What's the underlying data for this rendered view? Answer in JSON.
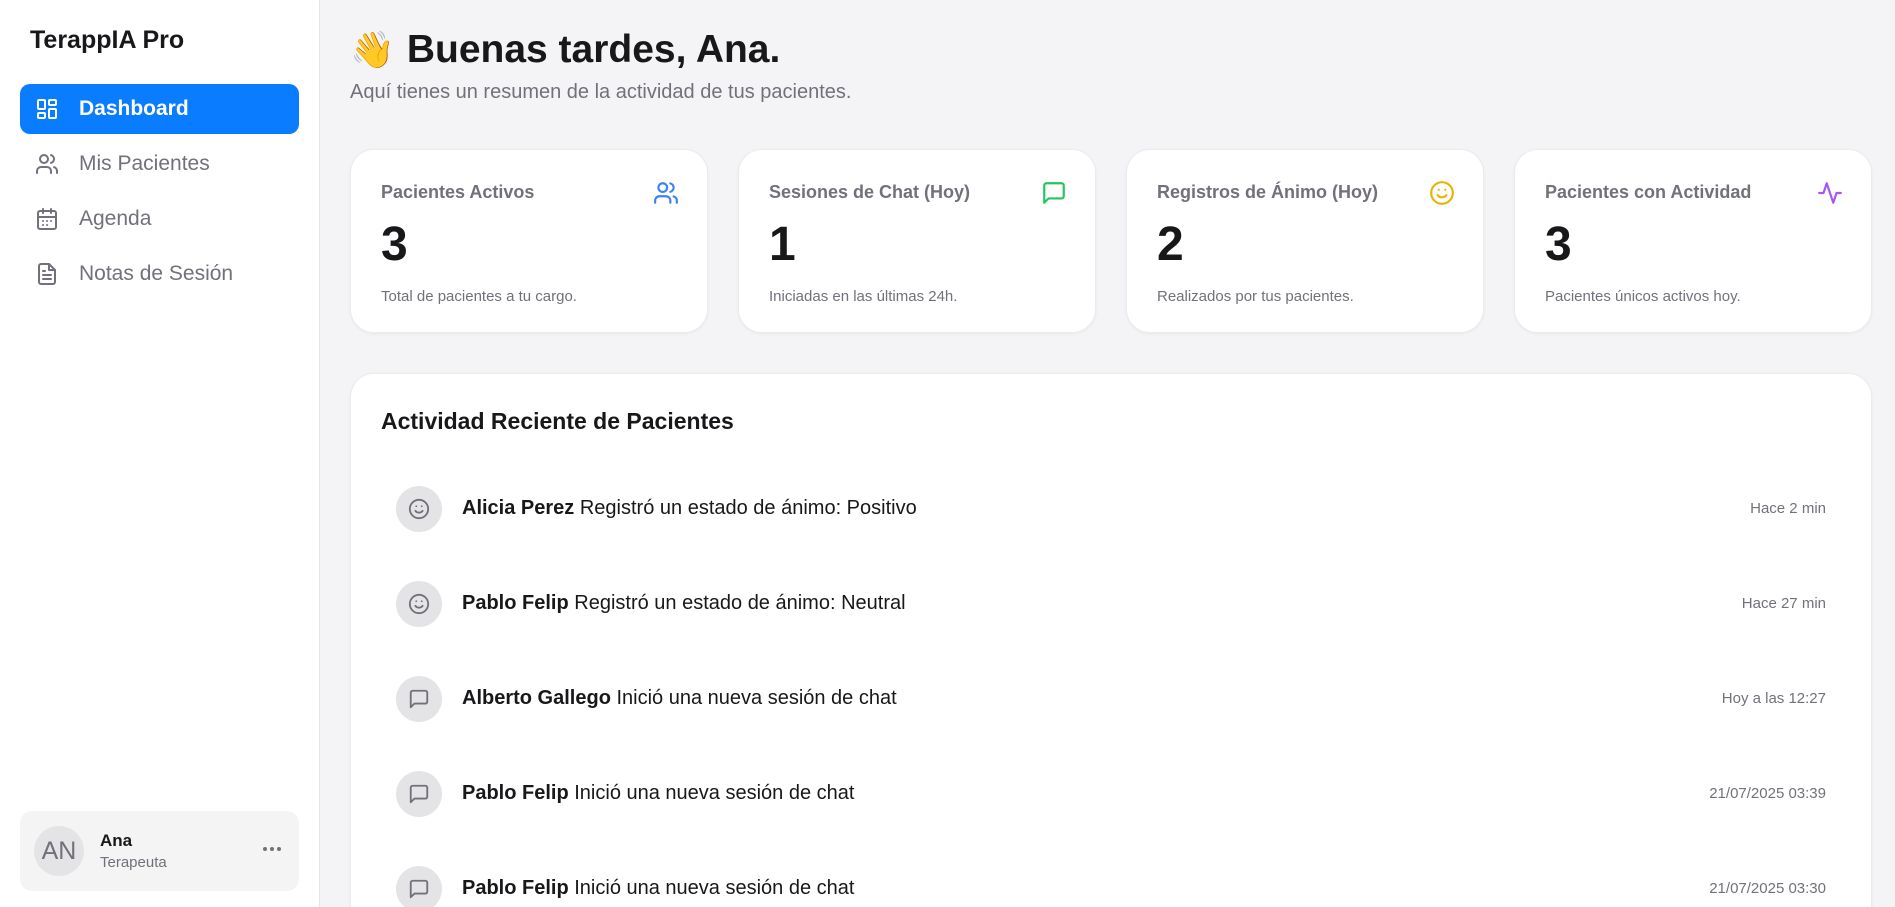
{
  "app": {
    "brand": "TerappIA Pro"
  },
  "sidebar": {
    "items": [
      {
        "label": "Dashboard",
        "icon": "dashboard-icon",
        "active": true
      },
      {
        "label": "Mis Pacientes",
        "icon": "users-icon",
        "active": false
      },
      {
        "label": "Agenda",
        "icon": "calendar-icon",
        "active": false
      },
      {
        "label": "Notas de Sesión",
        "icon": "document-icon",
        "active": false
      }
    ],
    "user": {
      "initials": "AN",
      "name": "Ana",
      "role": "Terapeuta"
    }
  },
  "header": {
    "wave_emoji": "👋",
    "greeting": "Buenas tardes, Ana.",
    "subtitle": "Aquí tienes un resumen de la actividad de tus pacientes."
  },
  "stats": [
    {
      "title": "Pacientes Activos",
      "value": "3",
      "description": "Total de pacientes a tu cargo.",
      "icon": "users-icon",
      "color": "#3b82f6"
    },
    {
      "title": "Sesiones de Chat (Hoy)",
      "value": "1",
      "description": "Iniciadas en las últimas 24h.",
      "icon": "chat-icon",
      "color": "#22c55e"
    },
    {
      "title": "Registros de Ánimo (Hoy)",
      "value": "2",
      "description": "Realizados por tus pacientes.",
      "icon": "smile-icon",
      "color": "#eab308"
    },
    {
      "title": "Pacientes con Actividad",
      "value": "3",
      "description": "Pacientes únicos activos hoy.",
      "icon": "activity-icon",
      "color": "#a855f7"
    }
  ],
  "activity": {
    "title": "Actividad Reciente de Pacientes",
    "items": [
      {
        "patient": "Alicia Perez",
        "action": "Registró un estado de ánimo: Positivo",
        "time": "Hace 2 min",
        "icon": "smile-icon"
      },
      {
        "patient": "Pablo Felip",
        "action": "Registró un estado de ánimo: Neutral",
        "time": "Hace 27 min",
        "icon": "smile-icon"
      },
      {
        "patient": "Alberto Gallego",
        "action": "Inició una nueva sesión de chat",
        "time": "Hoy a las 12:27",
        "icon": "chat-icon"
      },
      {
        "patient": "Pablo Felip",
        "action": "Inició una nueva sesión de chat",
        "time": "21/07/2025 03:39",
        "icon": "chat-icon"
      },
      {
        "patient": "Pablo Felip",
        "action": "Inició una nueva sesión de chat",
        "time": "21/07/2025 03:30",
        "icon": "chat-icon"
      }
    ]
  },
  "colors": {
    "accent": "#0a7cff",
    "muted": "#71717a",
    "background": "#f4f4f6"
  }
}
